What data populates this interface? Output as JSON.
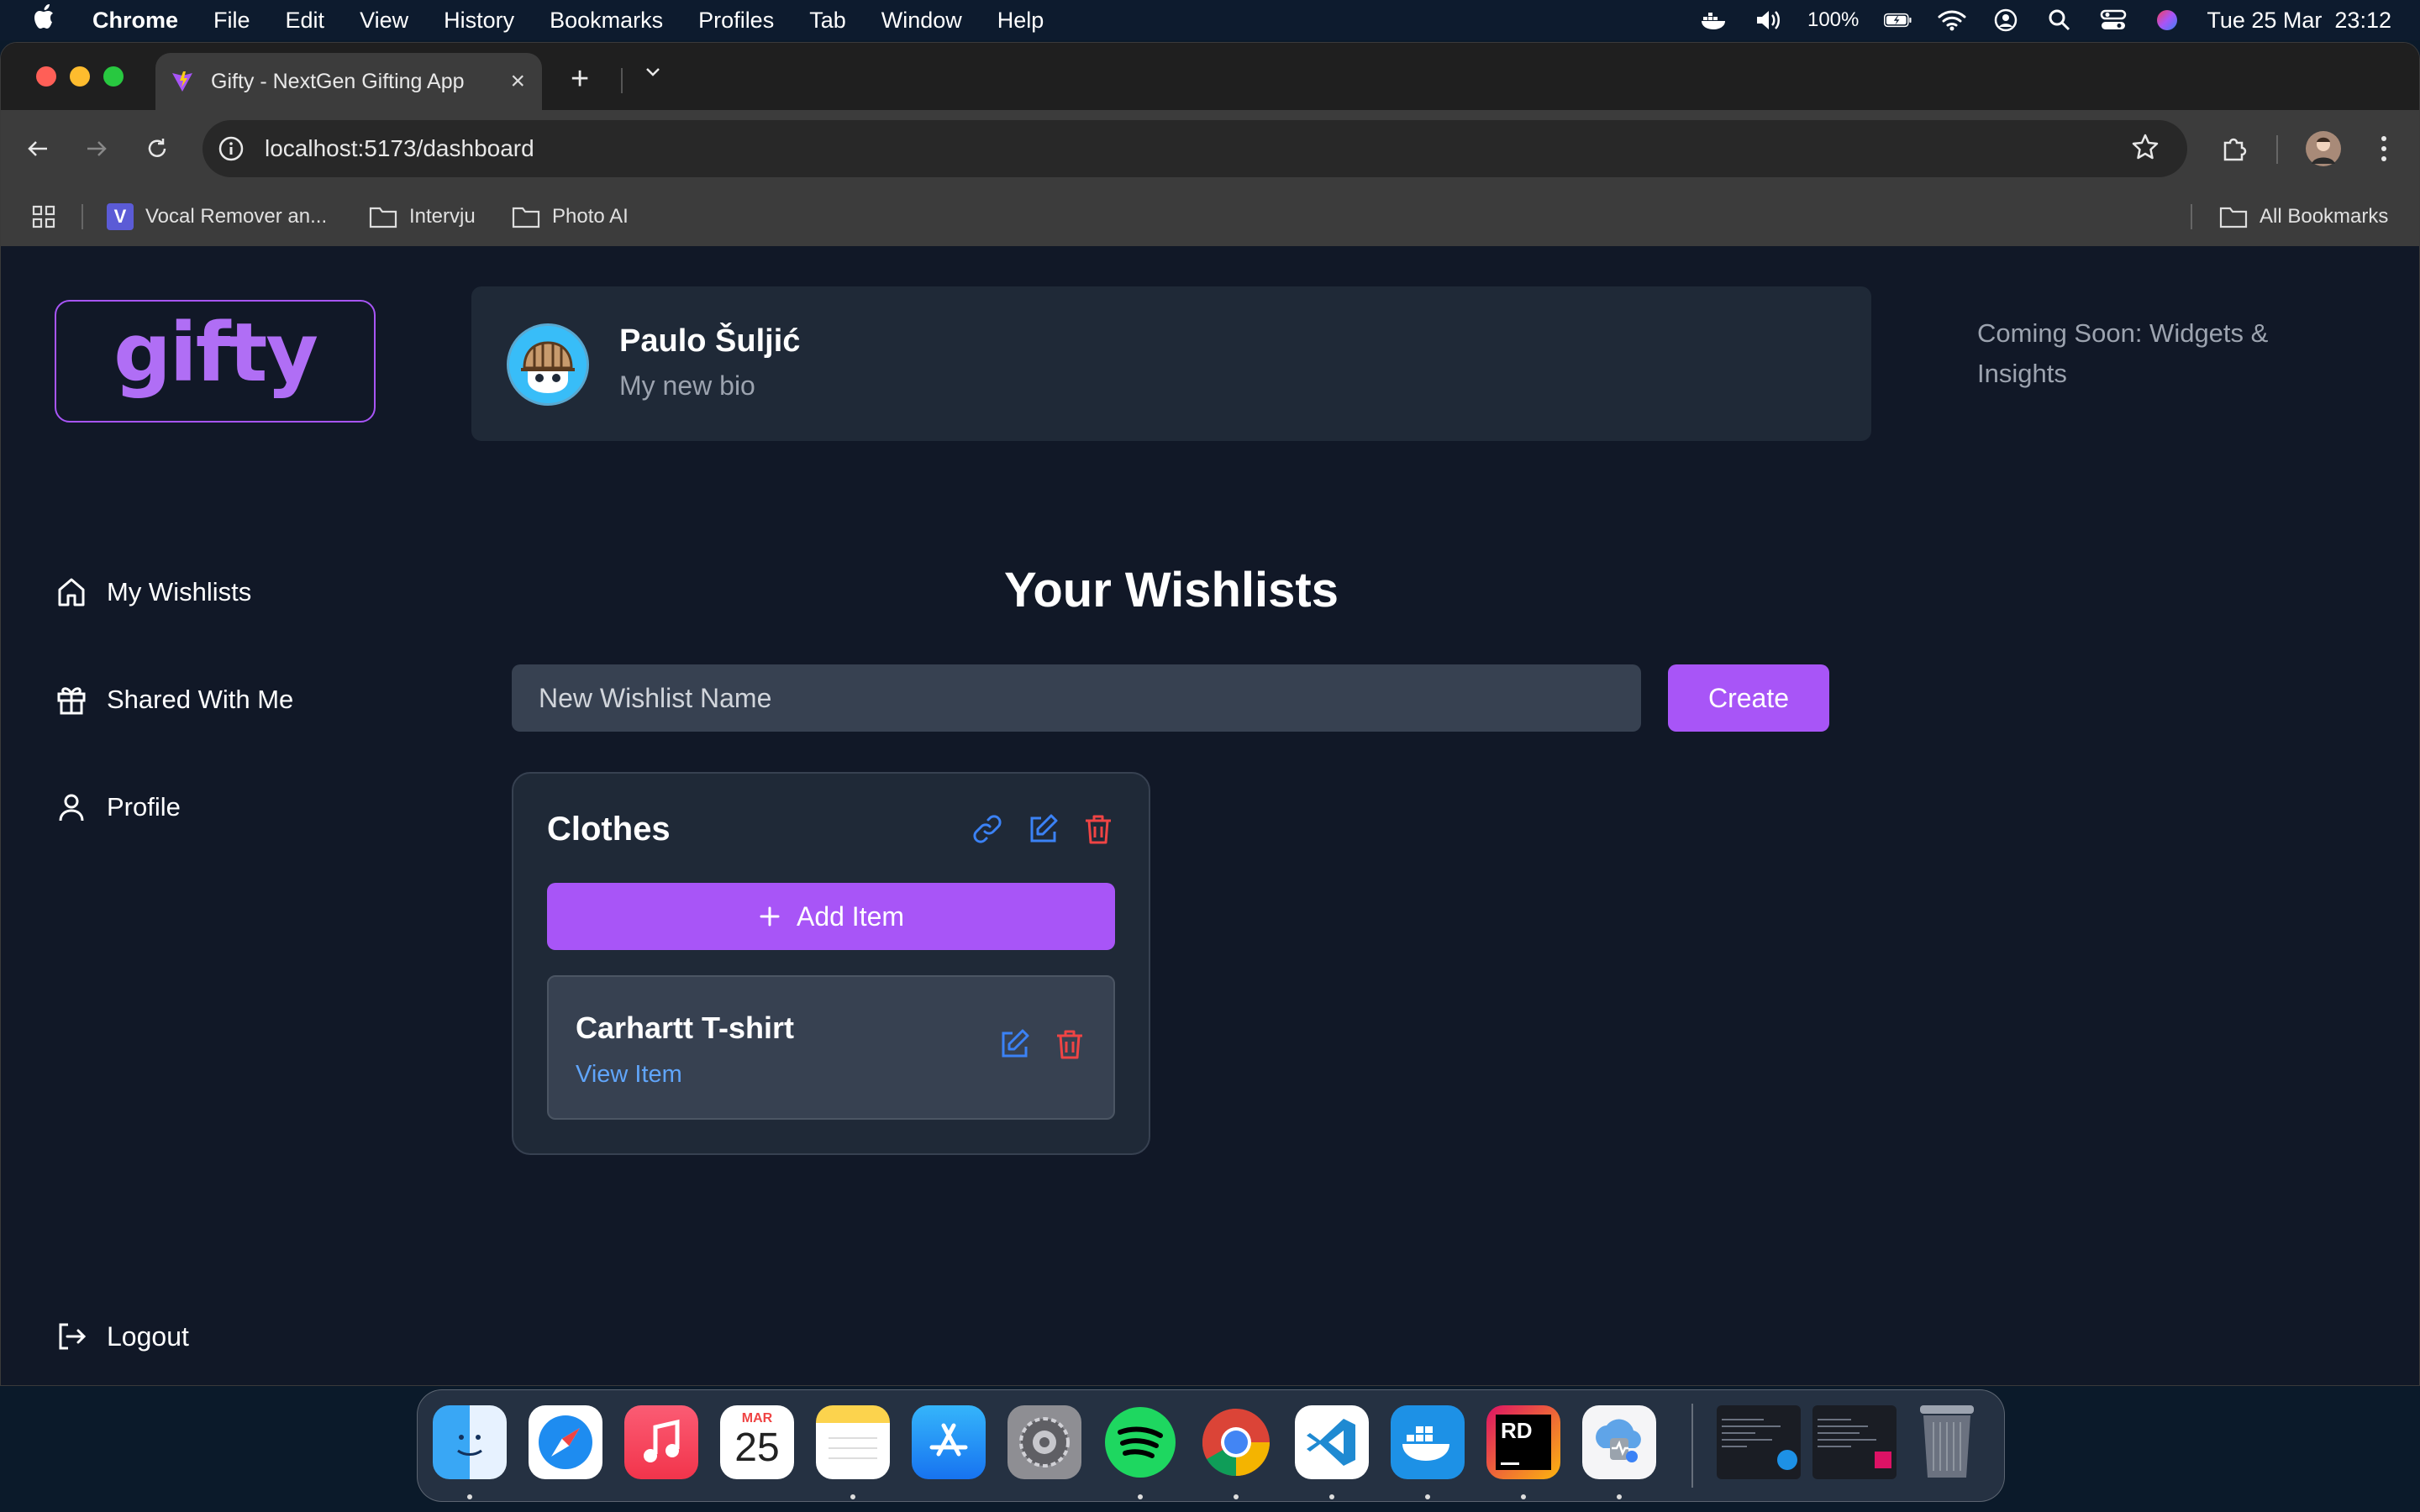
{
  "menubar": {
    "app_name": "Chrome",
    "menus": [
      "File",
      "Edit",
      "View",
      "History",
      "Bookmarks",
      "Profiles",
      "Tab",
      "Window",
      "Help"
    ],
    "battery": "100%",
    "datetime": "Tue 25 Mar  23:12"
  },
  "browser": {
    "tab_title": "Gifty - NextGen Gifting App",
    "url": "localhost:5173/dashboard",
    "bookmarks": [
      "Vocal Remover an...",
      "Intervju",
      "Photo AI"
    ],
    "all_bookmarks": "All Bookmarks"
  },
  "sidebar": {
    "logo_text": "gifty",
    "items": [
      {
        "label": "My Wishlists",
        "icon": "home-icon"
      },
      {
        "label": "Shared With Me",
        "icon": "gift-icon"
      },
      {
        "label": "Profile",
        "icon": "user-icon"
      }
    ],
    "logout_label": "Logout"
  },
  "profile": {
    "name": "Paulo Šuljić",
    "bio": "My new bio"
  },
  "right_panel": {
    "coming_soon": "Coming Soon: Widgets & Insights"
  },
  "main": {
    "heading": "Your Wishlists",
    "new_wishlist_placeholder": "New Wishlist Name",
    "create_label": "Create",
    "wishlists": [
      {
        "title": "Clothes",
        "add_item_label": "Add Item",
        "items": [
          {
            "title": "Carhartt T-shirt",
            "link_label": "View Item"
          }
        ]
      }
    ]
  },
  "colors": {
    "accent": "#a855f7",
    "link": "#60a5fa",
    "danger": "#ef4444",
    "background": "#111827",
    "card": "#1f2937"
  },
  "dock": {
    "calendar_month": "MAR",
    "calendar_day": "25",
    "apps": [
      "finder-icon",
      "safari-icon",
      "music-icon",
      "calendar-icon",
      "notes-icon",
      "app-store-icon",
      "system-settings-icon",
      "spotify-icon",
      "chrome-icon",
      "vscode-icon",
      "docker-icon",
      "rider-icon",
      "disk-utility-icon",
      "window-thumb-1",
      "window-thumb-2",
      "trash-icon"
    ]
  }
}
